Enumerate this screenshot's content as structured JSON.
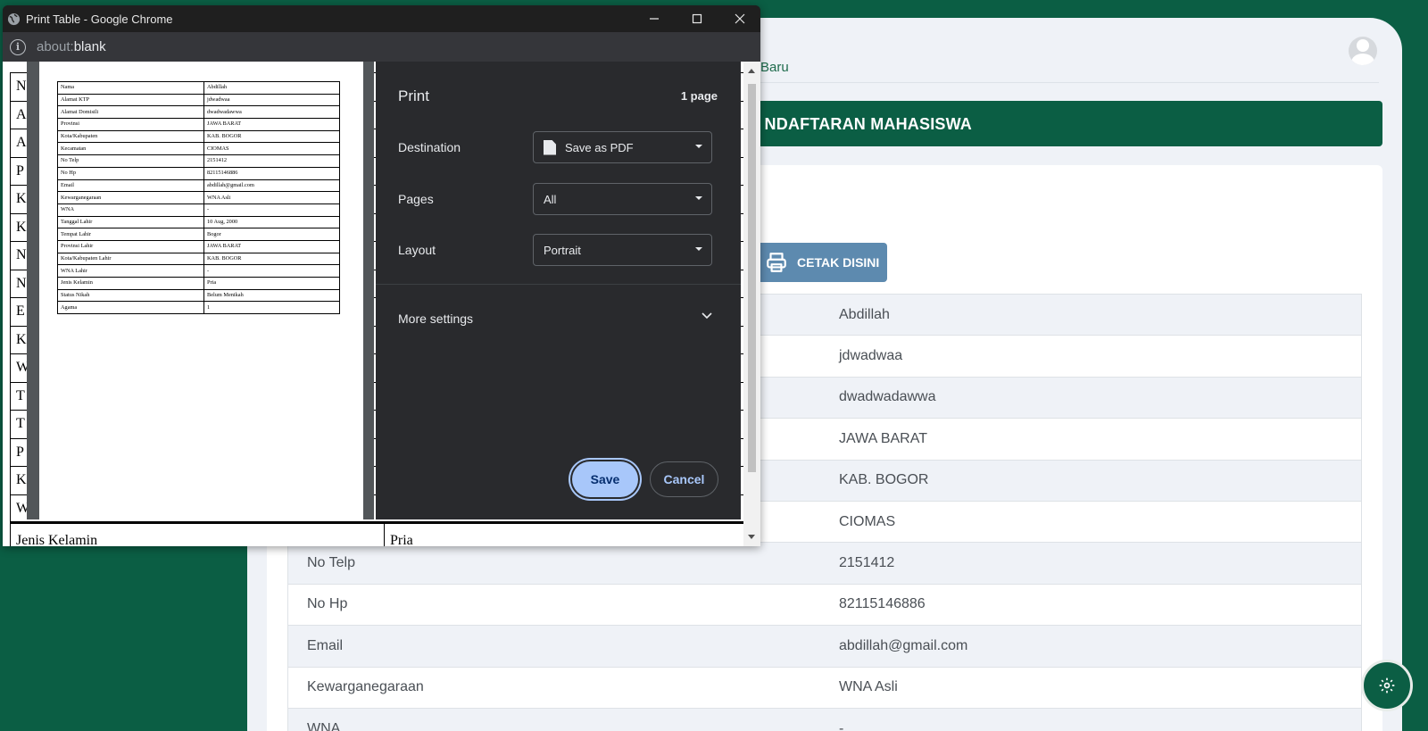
{
  "app": {
    "nav_link": "Baru",
    "page_title": "NDAFTARAN MAHASISWA",
    "print_button": "CETAK DISINI",
    "rows": [
      {
        "label": "",
        "value": "Abdillah"
      },
      {
        "label": "",
        "value": "jdwadwaa"
      },
      {
        "label": "",
        "value": "dwadwadawwa"
      },
      {
        "label": "",
        "value": "JAWA BARAT"
      },
      {
        "label": "",
        "value": "KAB. BOGOR"
      },
      {
        "label": "",
        "value": "CIOMAS"
      },
      {
        "label": "No Telp",
        "value": "2151412"
      },
      {
        "label": "No Hp",
        "value": "82115146886"
      },
      {
        "label": "Email",
        "value": "abdillah@gmail.com"
      },
      {
        "label": "Kewarganegaraan",
        "value": "WNA Asli"
      },
      {
        "label": "WNA",
        "value": "-"
      }
    ]
  },
  "chrome": {
    "window_title": "Print Table - Google Chrome",
    "url_scheme": "about:",
    "url_path": "blank",
    "underlying_initials": [
      "N",
      "A",
      "A",
      "P",
      "K",
      "K",
      "N",
      "N",
      "E",
      "K",
      "W",
      "T",
      "T",
      "P",
      "K",
      "W"
    ],
    "underlying_last_row": {
      "label": "Jenis Kelamin",
      "value": "Pria"
    }
  },
  "preview_rows": [
    [
      "Nama",
      "Abdillah"
    ],
    [
      "Alamat KTP",
      "jdwadwaa"
    ],
    [
      "Alamat Domisili",
      "dwadwadawwa"
    ],
    [
      "Provinsi",
      "JAWA BARAT"
    ],
    [
      "Kota/Kabupaten",
      "KAB. BOGOR"
    ],
    [
      "Kecamatan",
      "CIOMAS"
    ],
    [
      "No Telp",
      "2151412"
    ],
    [
      "No Hp",
      "82115146886"
    ],
    [
      "Email",
      "abdillah@gmail.com"
    ],
    [
      "Kewarganegaraan",
      "WNA Asli"
    ],
    [
      "WNA",
      "-"
    ],
    [
      "Tanggal Lahir",
      "10 Aug, 2000"
    ],
    [
      "Tempat Lahir",
      "Bogor"
    ],
    [
      "Provinsi Lahir",
      "JAWA BARAT"
    ],
    [
      "Kota/Kabupaten Lahir",
      "KAB. BOGOR"
    ],
    [
      "WNA Lahir",
      "-"
    ],
    [
      "Jenis Kelamin",
      "Pria"
    ],
    [
      "Status Nikah",
      "Belum Menikah"
    ],
    [
      "Agama",
      "1"
    ]
  ],
  "print_dialog": {
    "title": "Print",
    "page_count": "1 page",
    "destination_label": "Destination",
    "destination_value": "Save as PDF",
    "pages_label": "Pages",
    "pages_value": "All",
    "layout_label": "Layout",
    "layout_value": "Portrait",
    "more_settings": "More settings",
    "save_button": "Save",
    "cancel_button": "Cancel"
  },
  "colors": {
    "brand_green": "#0b5e44",
    "print_button": "#5d8aaf",
    "dialog_bg": "#292a2d",
    "accent_blue": "#a8c7fa"
  }
}
